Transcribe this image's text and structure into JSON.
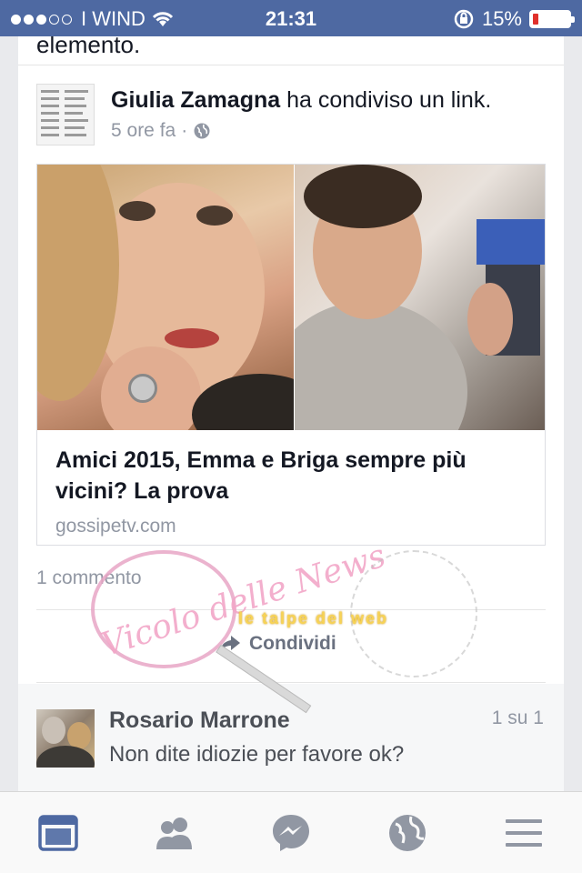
{
  "status_bar": {
    "carrier": "I WIND",
    "time": "21:31",
    "battery_text": "15%",
    "battery_level": 0.15
  },
  "previous_post": {
    "cut_text": "elemento."
  },
  "post": {
    "author": "Giulia Zamagna",
    "action": "ha condiviso un link.",
    "time": "5 ore fa",
    "link": {
      "title_line1": "Amici 2015, Emma e Briga sempre più",
      "title_line2": "vicini? La prova",
      "domain": "gossipetv.com"
    },
    "comment_count": "1 commento",
    "share_label": "Condividi"
  },
  "comment": {
    "author": "Rosario Marrone",
    "counter": "1 su 1",
    "text": "Non dite idiozie per favore ok?"
  },
  "watermarks": {
    "left": "Vicolo delle News",
    "right": "le talpe del web"
  },
  "tabs": [
    {
      "icon": "news-feed-icon",
      "active": true
    },
    {
      "icon": "friends-icon",
      "active": false
    },
    {
      "icon": "messenger-icon",
      "active": false
    },
    {
      "icon": "globe-icon",
      "active": false
    },
    {
      "icon": "menu-icon",
      "active": false
    }
  ],
  "colors": {
    "brand_blue": "#4e69a2",
    "active_tab": "#4e69a2",
    "inactive_tab": "#9197a3",
    "battery_low": "#e0302b"
  }
}
